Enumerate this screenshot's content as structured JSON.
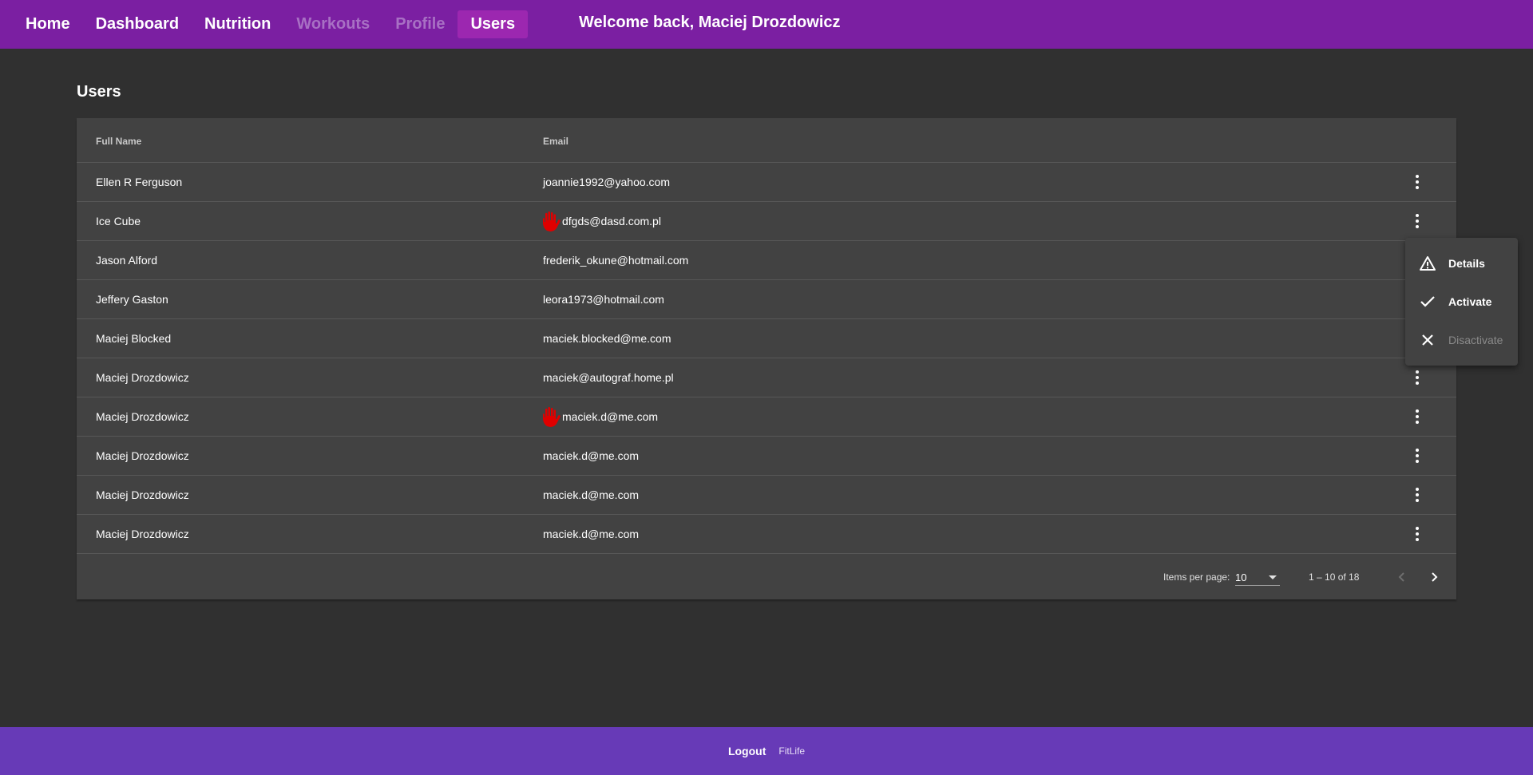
{
  "nav": {
    "items": [
      {
        "label": "Home"
      },
      {
        "label": "Dashboard"
      },
      {
        "label": "Nutrition"
      },
      {
        "label": "Workouts"
      },
      {
        "label": "Profile"
      },
      {
        "label": "Users"
      }
    ],
    "welcome": "Welcome back, Maciej Drozdowicz"
  },
  "page": {
    "title": "Users"
  },
  "table": {
    "headers": {
      "name": "Full Name",
      "email": "Email"
    },
    "rows": [
      {
        "name": "Ellen R Ferguson",
        "email": "joannie1992@yahoo.com"
      },
      {
        "name": "Ice Cube",
        "email": "dfgds@dasd.com.pl"
      },
      {
        "name": "Jason Alford",
        "email": "frederik_okune@hotmail.com"
      },
      {
        "name": "Jeffery Gaston",
        "email": "leora1973@hotmail.com"
      },
      {
        "name": "Maciej Blocked",
        "email": "maciek.blocked@me.com"
      },
      {
        "name": "Maciej Drozdowicz",
        "email": "maciek@autograf.home.pl"
      },
      {
        "name": "Maciej Drozdowicz",
        "email": "maciek.d@me.com"
      },
      {
        "name": "Maciej Drozdowicz",
        "email": "maciek.d@me.com"
      },
      {
        "name": "Maciej Drozdowicz",
        "email": "maciek.d@me.com"
      },
      {
        "name": "Maciej Drozdowicz",
        "email": "maciek.d@me.com"
      }
    ]
  },
  "paginator": {
    "items_per_page_label": "Items per page:",
    "items_per_page_value": "10",
    "range": "1 – 10 of 18"
  },
  "menu": {
    "items": [
      {
        "label": "Details",
        "icon": "warning-icon"
      },
      {
        "label": "Activate",
        "icon": "check-icon"
      },
      {
        "label": "Disactivate",
        "icon": "close-icon"
      }
    ]
  },
  "footer": {
    "logout": "Logout",
    "brand": "FitLife"
  },
  "colors": {
    "topbar": "#7b1fa2",
    "active_tab": "#9c27b0",
    "footer": "#673ab7",
    "background": "#303030",
    "card": "#424242",
    "blocked_icon": "#e00000"
  }
}
